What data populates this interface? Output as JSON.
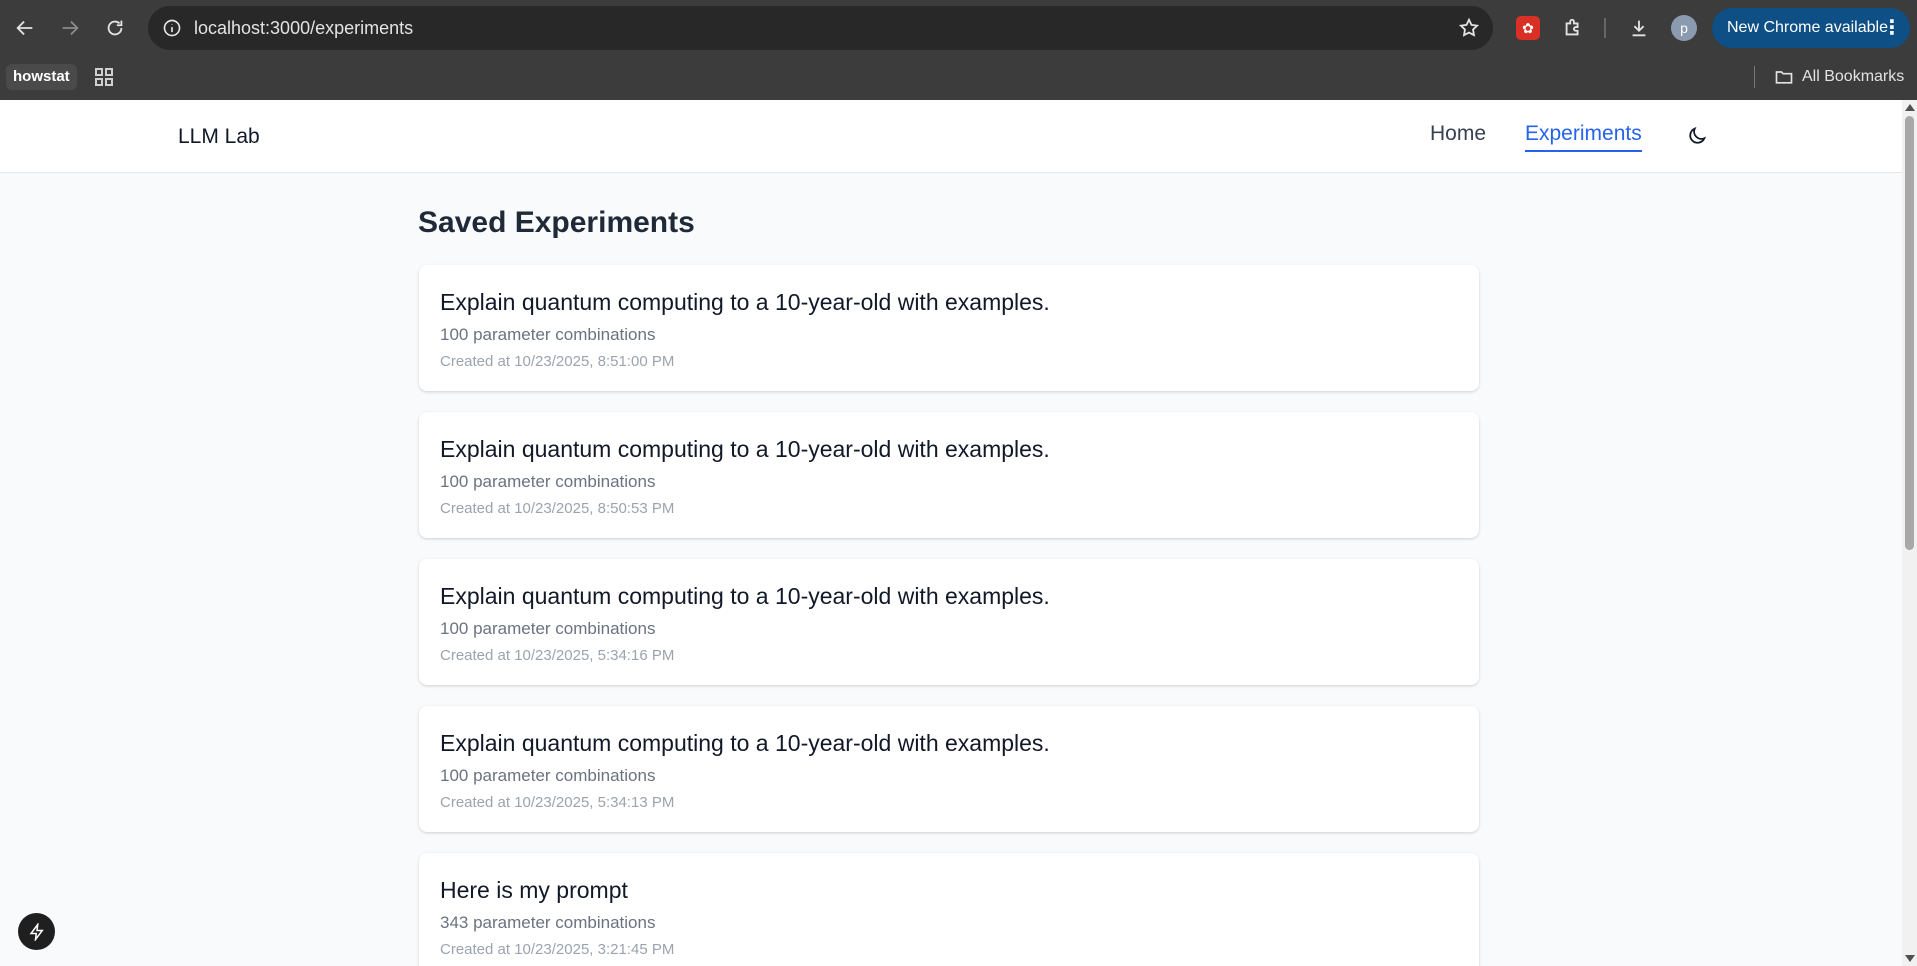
{
  "browser": {
    "url": "localhost:3000/experiments",
    "update_label": "New Chrome available",
    "profile_initial": "p",
    "bookmarks": {
      "chip": "howstat",
      "all_bookmarks": "All Bookmarks"
    }
  },
  "nav": {
    "brand": "LLM Lab",
    "links": [
      {
        "label": "Home"
      },
      {
        "label": "Experiments"
      }
    ],
    "active": "Experiments"
  },
  "page": {
    "title": "Saved Experiments"
  },
  "experiments": [
    {
      "title": "Explain quantum computing to a 10-year-old with examples.",
      "combos": "100 parameter combinations",
      "created": "Created at 10/23/2025, 8:51:00 PM"
    },
    {
      "title": "Explain quantum computing to a 10-year-old with examples.",
      "combos": "100 parameter combinations",
      "created": "Created at 10/23/2025, 8:50:53 PM"
    },
    {
      "title": "Explain quantum computing to a 10-year-old with examples.",
      "combos": "100 parameter combinations",
      "created": "Created at 10/23/2025, 5:34:16 PM"
    },
    {
      "title": "Explain quantum computing to a 10-year-old with examples.",
      "combos": "100 parameter combinations",
      "created": "Created at 10/23/2025, 5:34:13 PM"
    },
    {
      "title": "Here is my prompt",
      "combos": "343 parameter combinations",
      "created": "Created at 10/23/2025, 3:21:45 PM"
    }
  ],
  "colors": {
    "accent": "#2563eb",
    "page_bg": "#f8fafc",
    "chrome_bg": "#3c3c3c"
  }
}
